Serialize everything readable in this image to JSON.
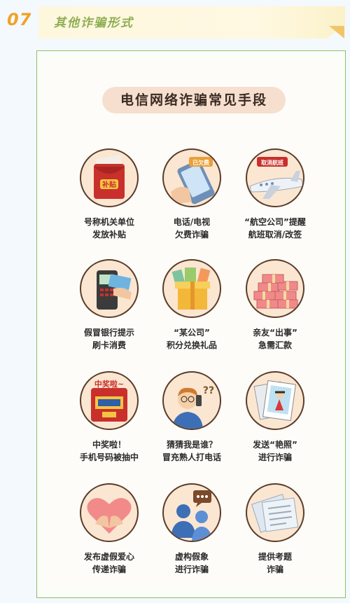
{
  "section": {
    "number": "07",
    "title": "其他诈骗形式"
  },
  "poster": {
    "title": "电信网络诈骗常见手段",
    "items": [
      {
        "line1": "号称机关单位",
        "line2": "发放补贴",
        "icon": "red-envelope-icon",
        "badge": "补贴"
      },
      {
        "line1": "电话/电视",
        "line2": "欠费诈骗",
        "icon": "phone-icon",
        "badge": "已欠费"
      },
      {
        "line1": "“航空公司”提醒",
        "line2": "航班取消/改签",
        "icon": "airplane-icon",
        "badge": "取消航班"
      },
      {
        "line1": "假冒银行提示",
        "line2": "刷卡消费",
        "icon": "card-terminal-icon",
        "badge": ""
      },
      {
        "line1": "“某公司”",
        "line2": "积分兑换礼品",
        "icon": "gift-box-icon",
        "badge": ""
      },
      {
        "line1": "亲友“出事”",
        "line2": "急需汇款",
        "icon": "cash-bundles-icon",
        "badge": ""
      },
      {
        "line1": "中奖啦！",
        "line2": "手机号码被抽中",
        "icon": "lottery-icon",
        "badge": "中奖啦~"
      },
      {
        "line1": "猜猜我是谁？",
        "line2": "冒充熟人打电话",
        "icon": "caller-man-icon",
        "badge": "??"
      },
      {
        "line1": "发送“艳照”",
        "line2": "进行诈骗",
        "icon": "photo-icon",
        "badge": ""
      },
      {
        "line1": "发布虚假爱心",
        "line2": "传递诈骗",
        "icon": "heart-hands-icon",
        "badge": ""
      },
      {
        "line1": "虚构假象",
        "line2": "进行诈骗",
        "icon": "chat-people-icon",
        "badge": ""
      },
      {
        "line1": "提供考题",
        "line2": "诈骗",
        "icon": "exam-paper-icon",
        "badge": ""
      }
    ]
  },
  "colors": {
    "accent": "#f0a22a",
    "title_green": "#8fae52",
    "border_green": "#8fbd6a",
    "icon_outline": "#5a3d2b"
  }
}
